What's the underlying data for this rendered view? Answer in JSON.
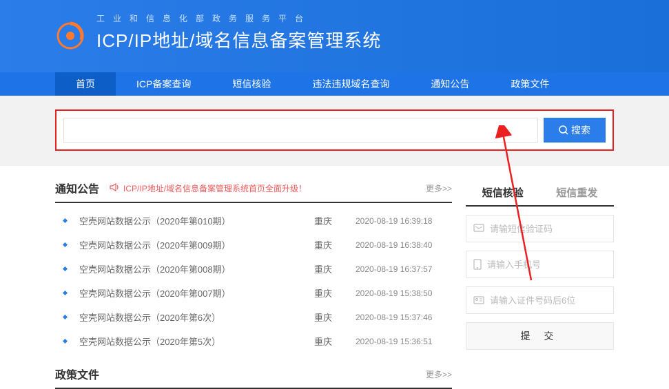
{
  "header": {
    "subtitle": "工业和信息化部政务服务平台",
    "title": "ICP/IP地址/域名信息备案管理系统"
  },
  "nav": {
    "items": [
      "首页",
      "ICP备案查询",
      "短信核验",
      "违法违规域名查询",
      "通知公告",
      "政策文件"
    ],
    "active_index": 0
  },
  "search": {
    "button_label": "搜索",
    "value": ""
  },
  "notice": {
    "section_title": "通知公告",
    "marquee": "ICP/IP地址/域名信息备案管理系统首页全面升级！",
    "more_label": "更多>>",
    "items": [
      {
        "title": "空壳网站数据公示（2020年第010期）",
        "region": "重庆",
        "date": "2020-08-19 16:39:18"
      },
      {
        "title": "空壳网站数据公示（2020年第009期）",
        "region": "重庆",
        "date": "2020-08-19 16:38:40"
      },
      {
        "title": "空壳网站数据公示（2020年第008期）",
        "region": "重庆",
        "date": "2020-08-19 16:37:57"
      },
      {
        "title": "空壳网站数据公示（2020年第007期）",
        "region": "重庆",
        "date": "2020-08-19 15:38:50"
      },
      {
        "title": "空壳网站数据公示（2020年第6次）",
        "region": "重庆",
        "date": "2020-08-19 15:37:46"
      },
      {
        "title": "空壳网站数据公示（2020年第5次）",
        "region": "重庆",
        "date": "2020-08-19 15:36:51"
      }
    ]
  },
  "verify": {
    "tabs": [
      "短信核验",
      "短信重发"
    ],
    "active_tab": 0,
    "placeholders": {
      "code": "请输短信验证码",
      "phone": "请输入手机号",
      "id": "请输入证件号码后6位"
    },
    "submit_label": "提 交"
  },
  "policy": {
    "section_title": "政策文件",
    "more_label": "更多>>"
  }
}
